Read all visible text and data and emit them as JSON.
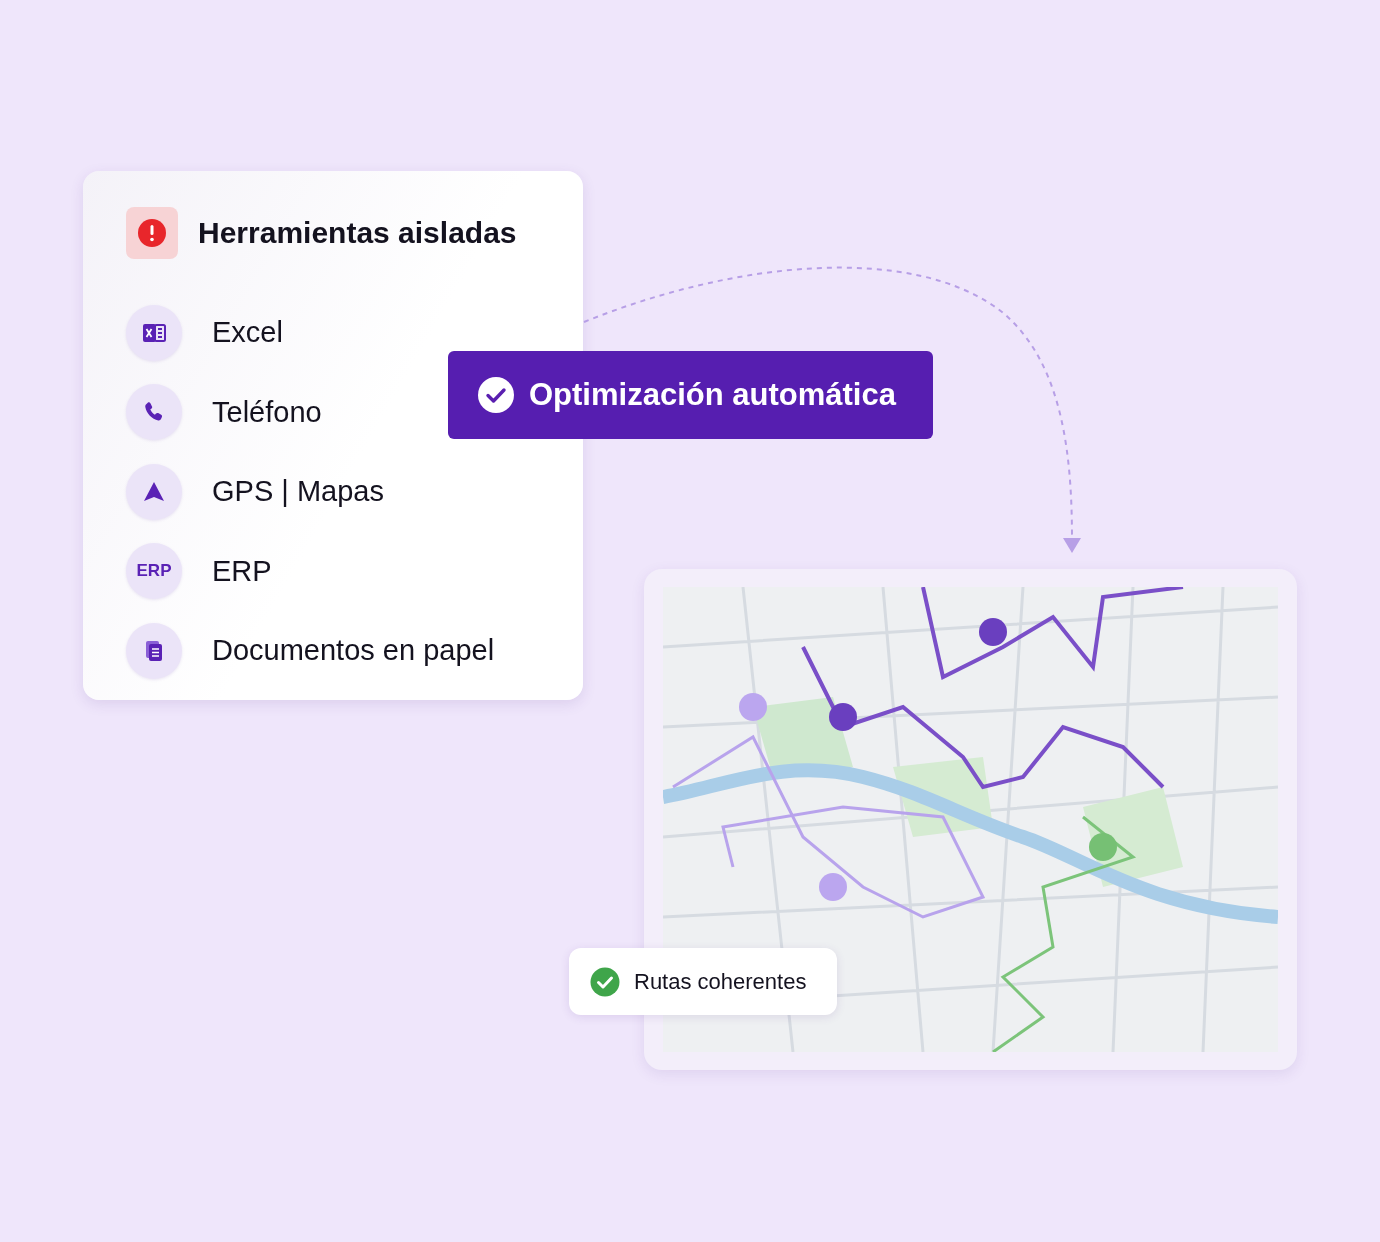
{
  "tools_card": {
    "title": "Herramientas aisladas",
    "items": [
      {
        "kind": "excel",
        "label": "Excel"
      },
      {
        "kind": "phone",
        "label": "Teléfono"
      },
      {
        "kind": "gps",
        "label": "GPS | Mapas"
      },
      {
        "kind": "erp",
        "label": "ERP",
        "icon_text": "ERP"
      },
      {
        "kind": "docs",
        "label": "Documentos en papel"
      }
    ]
  },
  "optimization_badge": {
    "label": "Optimización automática"
  },
  "routes_badge": {
    "label": "Rutas coherentes"
  }
}
